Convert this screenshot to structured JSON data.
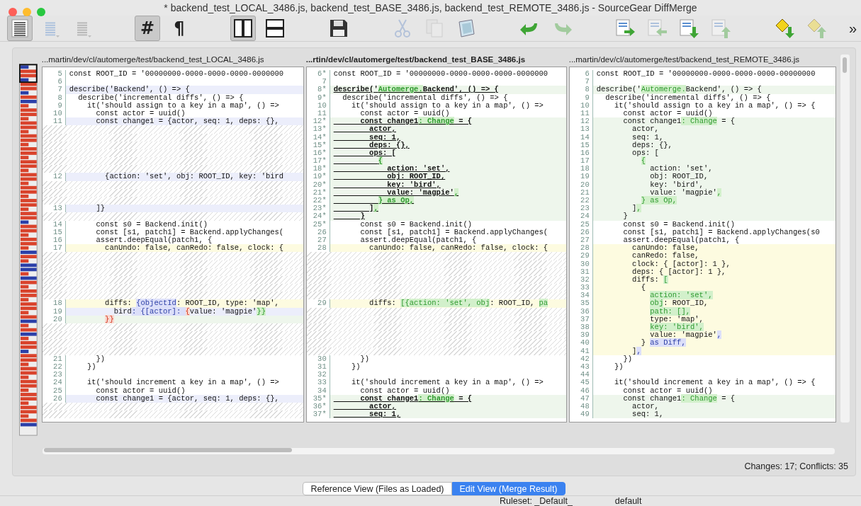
{
  "window": {
    "title": "* backend_test_LOCAL_3486.js, backend_test_BASE_3486.js, backend_test_REMOTE_3486.js - SourceGear DiffMerge"
  },
  "toolbar": {
    "groups": [
      [
        {
          "kind": "doc-lines",
          "pressed": true,
          "disabled": false
        },
        {
          "kind": "aligned-lines",
          "pressed": false,
          "disabled": true
        },
        {
          "kind": "plain-lines",
          "pressed": false,
          "disabled": true
        }
      ],
      [
        {
          "kind": "char",
          "text": "#",
          "pressed": true,
          "disabled": false
        },
        {
          "kind": "char",
          "text": "¶",
          "pressed": false,
          "disabled": false
        }
      ],
      [
        {
          "kind": "columns",
          "pressed": true,
          "disabled": false
        },
        {
          "kind": "rows",
          "pressed": false,
          "disabled": false
        }
      ],
      [
        {
          "kind": "save",
          "pressed": false,
          "disabled": false
        }
      ],
      [
        {
          "kind": "scissors",
          "pressed": false,
          "disabled": true
        },
        {
          "kind": "copy",
          "pressed": false,
          "disabled": true
        },
        {
          "kind": "paste",
          "pressed": false,
          "disabled": false
        }
      ],
      [
        {
          "kind": "undo",
          "pressed": false,
          "disabled": false
        },
        {
          "kind": "redo",
          "pressed": false,
          "disabled": true
        }
      ],
      [
        {
          "kind": "arrow-right",
          "pressed": false,
          "disabled": false
        },
        {
          "kind": "arrow-left",
          "pressed": false,
          "disabled": true
        },
        {
          "kind": "arrow-down",
          "pressed": false,
          "disabled": false
        },
        {
          "kind": "arrow-up",
          "pressed": false,
          "disabled": true
        }
      ],
      [
        {
          "kind": "diamond-down",
          "pressed": false,
          "disabled": false
        },
        {
          "kind": "diamond-up",
          "pressed": false,
          "disabled": true
        }
      ]
    ],
    "overflow": "»"
  },
  "panes": [
    {
      "path": "...martin/dev/cl/automerge/test/backend_test_LOCAL_3486.js",
      "selected": false,
      "lines": [
        {
          "kind": "code",
          "num": "5",
          "text": "const ROOT_ID = '00000000-0000-0000-0000-0000000"
        },
        {
          "kind": "code",
          "num": "6"
        },
        {
          "kind": "code",
          "num": "7",
          "text": "describe('Backend', () => {",
          "color": "#eceefb"
        },
        {
          "kind": "code",
          "num": "8",
          "text": "  describe('incremental diffs', () => {"
        },
        {
          "kind": "code",
          "num": "9",
          "text": "    it('should assign to a key in a map', () =>"
        },
        {
          "kind": "code",
          "num": "10",
          "text": "      const actor = uuid()"
        },
        {
          "kind": "code",
          "num": "11",
          "text": "      const change1 = {actor, seq: 1, deps: {},",
          "color": "#eceefb"
        },
        {
          "kind": "gap"
        },
        {
          "kind": "gap"
        },
        {
          "kind": "gap"
        },
        {
          "kind": "gap"
        },
        {
          "kind": "gap"
        },
        {
          "kind": "gap"
        },
        {
          "kind": "code",
          "num": "12",
          "text": "        {action: 'set', obj: ROOT_ID, key: 'bird",
          "color": "#eceefb"
        },
        {
          "kind": "gap"
        },
        {
          "kind": "gap"
        },
        {
          "kind": "gap"
        },
        {
          "kind": "code",
          "num": "13",
          "text": "      ]}",
          "color": "#eceefb"
        },
        {
          "kind": "gap"
        },
        {
          "kind": "code",
          "num": "14",
          "text": "      const s0 = Backend.init()"
        },
        {
          "kind": "code",
          "num": "15",
          "text": "      const [s1, patch1] = Backend.applyChanges("
        },
        {
          "kind": "code",
          "num": "16",
          "text": "      assert.deepEqual(patch1, {"
        },
        {
          "kind": "code",
          "num": "17",
          "text": "        canUndo: false, canRedo: false, clock: {",
          "color": "#fdfbe0"
        },
        {
          "kind": "gap"
        },
        {
          "kind": "gap"
        },
        {
          "kind": "gap"
        },
        {
          "kind": "gap"
        },
        {
          "kind": "gap"
        },
        {
          "kind": "gap"
        },
        {
          "kind": "code",
          "num": "18",
          "color": "#fdfbe0",
          "parts": [
            {
              "text": "        diffs: "
            },
            {
              "text": "{objectId",
              "color": "#dcdff9"
            },
            {
              "text": ": ROOT_ID, type: 'map',"
            }
          ]
        },
        {
          "kind": "code",
          "num": "19",
          "color": "#eceefb",
          "parts": [
            {
              "text": "          bird"
            },
            {
              "text": ": {[actor]: ",
              "color": "#dcdff9"
            },
            {
              "text": "{",
              "color": "#f8dad2"
            },
            {
              "text": "value: 'magpie'"
            },
            {
              "text": "}}",
              "color": "#d2f0cb"
            }
          ]
        },
        {
          "kind": "code",
          "num": "20",
          "color": "#eef6ec",
          "parts": [
            {
              "text": "        }}",
              "color": "#f8dad2"
            }
          ]
        },
        {
          "kind": "gap"
        },
        {
          "kind": "gap"
        },
        {
          "kind": "gap"
        },
        {
          "kind": "gap"
        },
        {
          "kind": "code",
          "num": "21",
          "text": "      })"
        },
        {
          "kind": "code",
          "num": "22",
          "text": "    })"
        },
        {
          "kind": "code",
          "num": "23"
        },
        {
          "kind": "code",
          "num": "24",
          "text": "    it('should increment a key in a map', () =>"
        },
        {
          "kind": "code",
          "num": "25",
          "text": "      const actor = uuid()"
        },
        {
          "kind": "code",
          "num": "26",
          "text": "      const change1 = {actor, seq: 1, deps: {},",
          "color": "#eceefb"
        },
        {
          "kind": "gap"
        },
        {
          "kind": "gap"
        }
      ]
    },
    {
      "path": "...rtin/dev/cl/automerge/test/backend_test_BASE_3486.js",
      "selected": true,
      "lines": [
        {
          "kind": "code",
          "num": "6*",
          "text": "const ROOT_ID = '00000000-0000-0000-0000-0000000"
        },
        {
          "kind": "code",
          "num": "7"
        },
        {
          "kind": "code",
          "num": "8*",
          "bold": true,
          "color": "#eef6ec",
          "parts": [
            {
              "text": "describe('"
            },
            {
              "text": "Automerge.",
              "color": "#d2f0cb"
            },
            {
              "text": "Backend', () => {"
            }
          ]
        },
        {
          "kind": "code",
          "num": "9*",
          "text": "  describe('incremental diffs', () => {"
        },
        {
          "kind": "code",
          "num": "10",
          "text": "    it('should assign to a key in a map', () =>"
        },
        {
          "kind": "code",
          "num": "11",
          "text": "      const actor = uuid()"
        },
        {
          "kind": "code",
          "num": "12*",
          "bold": true,
          "color": "#eef6ec",
          "parts": [
            {
              "text": "      const change1"
            },
            {
              "text": ": Change",
              "color": "#d2f0cb"
            },
            {
              "text": " = {"
            }
          ]
        },
        {
          "kind": "code",
          "num": "13*",
          "bold": true,
          "color": "#eef6ec",
          "text": "        actor,"
        },
        {
          "kind": "code",
          "num": "14*",
          "bold": true,
          "color": "#eef6ec",
          "text": "        seq: 1,"
        },
        {
          "kind": "code",
          "num": "15*",
          "bold": true,
          "color": "#eef6ec",
          "text": "        deps: {},"
        },
        {
          "kind": "code",
          "num": "16*",
          "bold": true,
          "color": "#eef6ec",
          "text": "        ops: ["
        },
        {
          "kind": "code",
          "num": "17*",
          "bold": true,
          "color": "#eef6ec",
          "parts": [
            {
              "text": "          {",
              "color": "#d2f0cb"
            }
          ]
        },
        {
          "kind": "code",
          "num": "18*",
          "bold": true,
          "color": "#eef6ec",
          "text": "            action: 'set',"
        },
        {
          "kind": "code",
          "num": "19*",
          "bold": true,
          "color": "#eef6ec",
          "text": "            obj: ROOT_ID,"
        },
        {
          "kind": "code",
          "num": "20*",
          "bold": true,
          "color": "#eef6ec",
          "text": "            key: 'bird',"
        },
        {
          "kind": "code",
          "num": "21*",
          "bold": true,
          "color": "#eef6ec",
          "parts": [
            {
              "text": "            value: 'magpie'"
            },
            {
              "text": ",",
              "color": "#d2f0cb"
            }
          ]
        },
        {
          "kind": "code",
          "num": "22*",
          "bold": true,
          "color": "#eef6ec",
          "parts": [
            {
              "text": "          } as Op,",
              "color": "#d2f0cb"
            }
          ]
        },
        {
          "kind": "code",
          "num": "23*",
          "bold": true,
          "color": "#eef6ec",
          "parts": [
            {
              "text": "        ]"
            },
            {
              "text": ",",
              "color": "#d2f0cb"
            }
          ]
        },
        {
          "kind": "code",
          "num": "24*",
          "bold": true,
          "color": "#eef6ec",
          "text": "      }"
        },
        {
          "kind": "code",
          "num": "25*",
          "text": "      const s0 = Backend.init()"
        },
        {
          "kind": "code",
          "num": "26",
          "text": "      const [s1, patch1] = Backend.applyChanges("
        },
        {
          "kind": "code",
          "num": "27",
          "text": "      assert.deepEqual(patch1, {"
        },
        {
          "kind": "code",
          "num": "28",
          "text": "        canUndo: false, canRedo: false, clock: {",
          "color": "#fdfbe0"
        },
        {
          "kind": "gap"
        },
        {
          "kind": "gap"
        },
        {
          "kind": "gap"
        },
        {
          "kind": "gap"
        },
        {
          "kind": "gap"
        },
        {
          "kind": "gap"
        },
        {
          "kind": "code",
          "num": "29",
          "color": "#fdfbe0",
          "parts": [
            {
              "text": "        diffs: "
            },
            {
              "text": "[{action: 'set', obj",
              "color": "#d2f0cb"
            },
            {
              "text": ": ROOT_ID, "
            },
            {
              "text": "pa",
              "color": "#d2f0cb"
            }
          ]
        },
        {
          "kind": "gap"
        },
        {
          "kind": "gap"
        },
        {
          "kind": "gap"
        },
        {
          "kind": "gap"
        },
        {
          "kind": "gap"
        },
        {
          "kind": "gap"
        },
        {
          "kind": "code",
          "num": "30",
          "text": "      })"
        },
        {
          "kind": "code",
          "num": "31",
          "text": "    })"
        },
        {
          "kind": "code",
          "num": "32"
        },
        {
          "kind": "code",
          "num": "33",
          "text": "    it('should increment a key in a map', () =>"
        },
        {
          "kind": "code",
          "num": "34",
          "text": "      const actor = uuid()"
        },
        {
          "kind": "code",
          "num": "35*",
          "bold": true,
          "color": "#eef6ec",
          "parts": [
            {
              "text": "      const change1"
            },
            {
              "text": ": Change",
              "color": "#d2f0cb"
            },
            {
              "text": " = {"
            }
          ]
        },
        {
          "kind": "code",
          "num": "36*",
          "bold": true,
          "color": "#eef6ec",
          "text": "        actor,"
        },
        {
          "kind": "code",
          "num": "37*",
          "bold": true,
          "color": "#eef6ec",
          "text": "        seq: 1,"
        }
      ]
    },
    {
      "path": "...martin/dev/cl/automerge/test/backend_test_REMOTE_3486.js",
      "selected": false,
      "lines": [
        {
          "kind": "code",
          "num": "6",
          "text": "const ROOT_ID = '00000000-0000-0000-0000-00000000"
        },
        {
          "kind": "code",
          "num": "7"
        },
        {
          "kind": "code",
          "num": "8",
          "color": "#eef6ec",
          "parts": [
            {
              "text": "describe('"
            },
            {
              "text": "Automerge.",
              "color": "#d2f0cb"
            },
            {
              "text": "Backend', () => {"
            }
          ]
        },
        {
          "kind": "code",
          "num": "9",
          "text": "  describe('incremental diffs', () => {"
        },
        {
          "kind": "code",
          "num": "10",
          "text": "    it('should assign to a key in a map', () => {"
        },
        {
          "kind": "code",
          "num": "11",
          "text": "      const actor = uuid()"
        },
        {
          "kind": "code",
          "num": "12",
          "color": "#eef6ec",
          "parts": [
            {
              "text": "      const change1"
            },
            {
              "text": ": Change",
              "color": "#d2f0cb"
            },
            {
              "text": " = {"
            }
          ]
        },
        {
          "kind": "code",
          "num": "13",
          "color": "#eef6ec",
          "text": "        actor,"
        },
        {
          "kind": "code",
          "num": "14",
          "color": "#eef6ec",
          "text": "        seq: 1,"
        },
        {
          "kind": "code",
          "num": "15",
          "color": "#eef6ec",
          "text": "        deps: {},"
        },
        {
          "kind": "code",
          "num": "16",
          "color": "#eef6ec",
          "text": "        ops: ["
        },
        {
          "kind": "code",
          "num": "17",
          "color": "#eef6ec",
          "parts": [
            {
              "text": "          {",
              "color": "#d2f0cb"
            }
          ]
        },
        {
          "kind": "code",
          "num": "18",
          "color": "#eef6ec",
          "text": "            action: 'set',"
        },
        {
          "kind": "code",
          "num": "19",
          "color": "#eef6ec",
          "text": "            obj: ROOT_ID,"
        },
        {
          "kind": "code",
          "num": "20",
          "color": "#eef6ec",
          "text": "            key: 'bird',"
        },
        {
          "kind": "code",
          "num": "21",
          "color": "#eef6ec",
          "parts": [
            {
              "text": "            value: 'magpie'"
            },
            {
              "text": ",",
              "color": "#d2f0cb"
            }
          ]
        },
        {
          "kind": "code",
          "num": "22",
          "color": "#eef6ec",
          "parts": [
            {
              "text": "          } as Op,",
              "color": "#d2f0cb"
            }
          ]
        },
        {
          "kind": "code",
          "num": "23",
          "color": "#eef6ec",
          "parts": [
            {
              "text": "        ]"
            },
            {
              "text": ",",
              "color": "#d2f0cb"
            }
          ]
        },
        {
          "kind": "code",
          "num": "24",
          "color": "#eef6ec",
          "text": "      }"
        },
        {
          "kind": "code",
          "num": "25",
          "text": "      const s0 = Backend.init()"
        },
        {
          "kind": "code",
          "num": "26",
          "text": "      const [s1, patch1] = Backend.applyChanges(s0"
        },
        {
          "kind": "code",
          "num": "27",
          "text": "      assert.deepEqual(patch1, {"
        },
        {
          "kind": "code",
          "num": "28",
          "color": "#fdfbe0",
          "text": "        canUndo: false,"
        },
        {
          "kind": "code",
          "num": "29",
          "color": "#fdfbe0",
          "text": "        canRedo: false,"
        },
        {
          "kind": "code",
          "num": "30",
          "color": "#fdfbe0",
          "text": "        clock: { [actor]: 1 },"
        },
        {
          "kind": "code",
          "num": "31",
          "color": "#fdfbe0",
          "text": "        deps: { [actor]: 1 },"
        },
        {
          "kind": "code",
          "num": "32",
          "color": "#fdfbe0",
          "parts": [
            {
              "text": "        diffs: "
            },
            {
              "text": "[",
              "color": "#d2f0cb"
            }
          ]
        },
        {
          "kind": "code",
          "num": "33",
          "color": "#fdfbe0",
          "text": "          {"
        },
        {
          "kind": "code",
          "num": "34",
          "color": "#fdfbe0",
          "parts": [
            {
              "text": "            action: 'set',",
              "color": "#d2f0cb"
            }
          ]
        },
        {
          "kind": "code",
          "num": "35",
          "color": "#fdfbe0",
          "parts": [
            {
              "text": "            obj",
              "color": "#d2f0cb"
            },
            {
              "text": ": ROOT_ID,"
            }
          ]
        },
        {
          "kind": "code",
          "num": "36",
          "color": "#fdfbe0",
          "parts": [
            {
              "text": "            path: [],",
              "color": "#d2f0cb"
            }
          ]
        },
        {
          "kind": "code",
          "num": "37",
          "color": "#fdfbe0",
          "text": "            type: 'map',"
        },
        {
          "kind": "code",
          "num": "38",
          "color": "#fdfbe0",
          "parts": [
            {
              "text": "            key: 'bird',",
              "color": "#d2f0cb"
            }
          ]
        },
        {
          "kind": "code",
          "num": "39",
          "color": "#fdfbe0",
          "parts": [
            {
              "text": "            value: 'magpie'"
            },
            {
              "text": ",",
              "color": "#dcdff9"
            }
          ]
        },
        {
          "kind": "code",
          "num": "40",
          "color": "#fdfbe0",
          "parts": [
            {
              "text": "          }"
            },
            {
              "text": " as Diff,",
              "color": "#dcdff9"
            }
          ]
        },
        {
          "kind": "code",
          "num": "41",
          "color": "#fdfbe0",
          "parts": [
            {
              "text": "        ]"
            },
            {
              "text": ",",
              "color": "#dcdff9"
            }
          ]
        },
        {
          "kind": "code",
          "num": "42",
          "text": "      })"
        },
        {
          "kind": "code",
          "num": "43",
          "text": "    })"
        },
        {
          "kind": "code",
          "num": "44"
        },
        {
          "kind": "code",
          "num": "45",
          "text": "    it('should increment a key in a map', () => {"
        },
        {
          "kind": "code",
          "num": "46",
          "text": "      const actor = uuid()"
        },
        {
          "kind": "code",
          "num": "47",
          "color": "#eef6ec",
          "parts": [
            {
              "text": "      const change1"
            },
            {
              "text": ": Change",
              "color": "#d2f0cb"
            },
            {
              "text": " = {"
            }
          ]
        },
        {
          "kind": "code",
          "num": "48",
          "color": "#eef6ec",
          "text": "        actor,"
        },
        {
          "kind": "code",
          "num": "49",
          "color": "#eef6ec",
          "text": "        seq: 1,"
        }
      ]
    }
  ],
  "summary": "Changes: 17; Conflicts: 35",
  "view_tabs": [
    {
      "label": "Reference View (Files as Loaded)",
      "selected": false
    },
    {
      "label": "Edit View (Merge Result)",
      "selected": true
    }
  ],
  "status_bar": {
    "ruleset": "Ruleset: _Default_",
    "encoding": "default"
  }
}
